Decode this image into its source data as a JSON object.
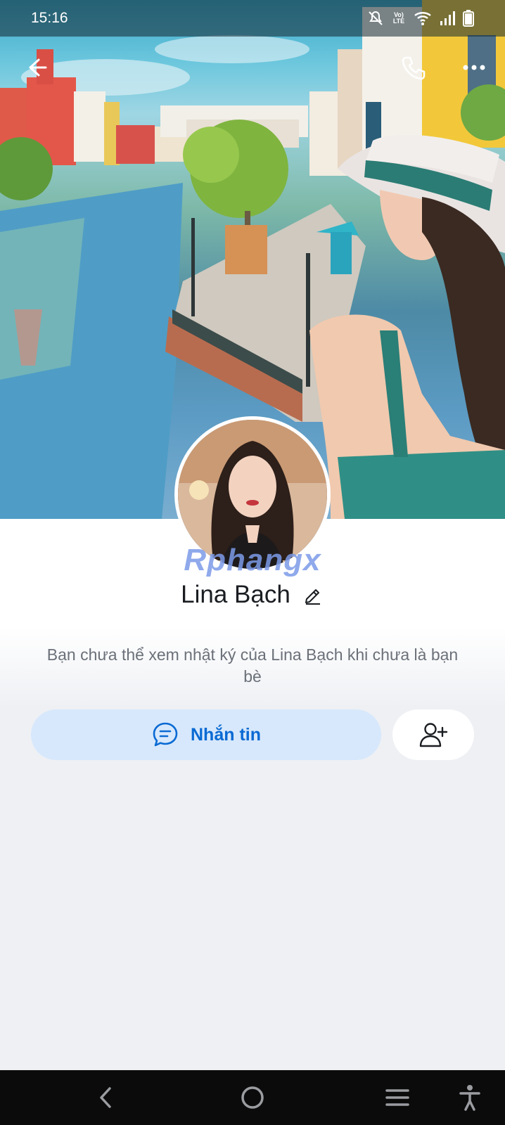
{
  "status_bar": {
    "time": "15:16",
    "lte_label": "Vo) LTE"
  },
  "profile": {
    "name": "Lina Bạch",
    "notice": "Bạn chưa thể xem nhật ký của Lina Bạch khi chưa là bạn bè",
    "watermark": "Rphangx"
  },
  "actions": {
    "message_label": "Nhắn tin"
  },
  "colors": {
    "accent": "#0a6ad3",
    "message_button_bg": "#d7e8fc",
    "page_bg": "#eef0f4"
  },
  "icons": {
    "back": "arrow-left-icon",
    "call": "phone-icon",
    "more": "more-dots-icon",
    "edit": "pencil-icon",
    "message": "chat-bubble-icon",
    "add_friend": "add-friend-icon",
    "nav_back": "chevron-left-icon",
    "nav_home": "circle-home-icon",
    "nav_recents": "menu-lines-icon",
    "nav_accessibility": "accessibility-icon"
  }
}
